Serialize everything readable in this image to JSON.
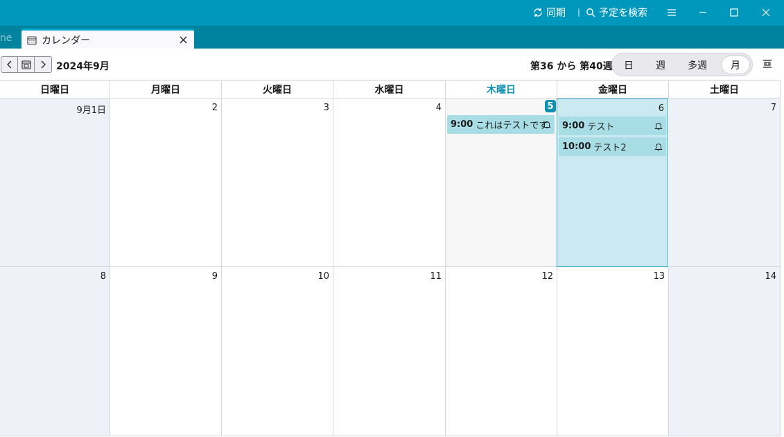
{
  "titlebar": {
    "sync_label": "同期",
    "search_label": "予定を検索",
    "icons": [
      "sync-icon",
      "search-icon",
      "menu-icon",
      "minimize-icon",
      "maximize-icon",
      "close-icon"
    ]
  },
  "tabs": {
    "partial_label": "ne",
    "active_label": "カレンダー"
  },
  "toolbar": {
    "month_title": "2024年9月",
    "week_range": "第36 から 第40週",
    "views": [
      "日",
      "週",
      "多週",
      "月"
    ],
    "active_view": "月"
  },
  "weekdays": [
    "日曜日",
    "月曜日",
    "火曜日",
    "水曜日",
    "木曜日",
    "金曜日",
    "土曜日"
  ],
  "week1": [
    "9月1日",
    "2",
    "3",
    "4",
    "5",
    "6",
    "7"
  ],
  "week2": [
    "8",
    "9",
    "10",
    "11",
    "12",
    "13",
    "14"
  ],
  "events": {
    "thu": {
      "time": "9:00",
      "title": "これはテストです"
    },
    "fri1": {
      "time": "9:00",
      "title": "テスト"
    },
    "fri2": {
      "time": "10:00",
      "title": "テスト2"
    }
  },
  "colors": {
    "titlebar": "#0097bd",
    "tabbar": "#00839e",
    "today_accent": "#0e8fb0",
    "selected_day": "#cbe9f1",
    "event": "#a8dde6",
    "weekend": "#eef1f8"
  }
}
